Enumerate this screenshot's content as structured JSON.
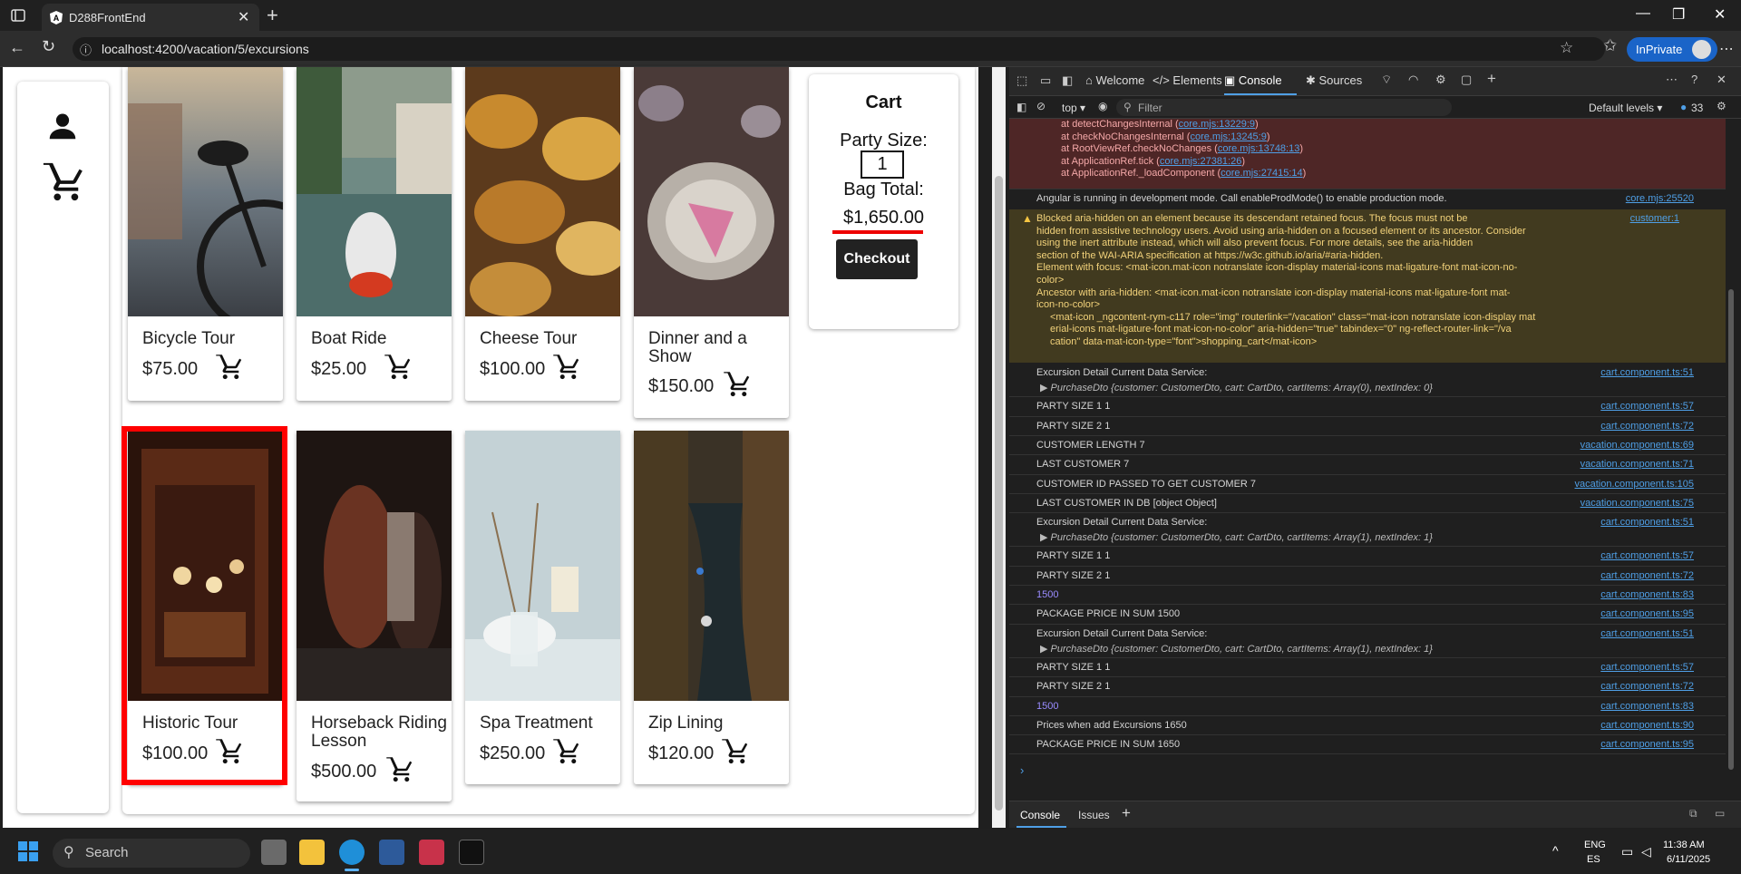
{
  "browser": {
    "tab_title": "D288FrontEnd",
    "url": "localhost:4200/vacation/5/excursions",
    "inprivate_label": "InPrivate"
  },
  "excursions": [
    {
      "title": "Bicycle Tour",
      "price": "$75.00"
    },
    {
      "title": "Boat Ride",
      "price": "$25.00"
    },
    {
      "title": "Cheese Tour",
      "price": "$100.00"
    },
    {
      "title": "Dinner and a Show",
      "price": "$150.00"
    },
    {
      "title": "Historic Tour",
      "price": "$100.00"
    },
    {
      "title": "Horseback Riding Lesson",
      "price": "$500.00"
    },
    {
      "title": "Spa Treatment",
      "price": "$250.00"
    },
    {
      "title": "Zip Lining",
      "price": "$120.00"
    }
  ],
  "cart": {
    "title": "Cart",
    "party_size_label": "Party Size:",
    "party_size_value": "1",
    "bag_total_label": "Bag Total:",
    "bag_total_value": "$1,650.00",
    "checkout_label": "Checkout"
  },
  "devtools": {
    "tabs": [
      "Welcome",
      "Elements",
      "Console",
      "Sources"
    ],
    "context": "top",
    "filter_placeholder": "Filter",
    "levels": "Default levels",
    "issue_count": "33",
    "bottom_tabs": [
      "Console",
      "Issues"
    ],
    "error_stack": [
      {
        "text": "at detectChangesInternal (",
        "src": "core.mjs:13229:9"
      },
      {
        "text": "at checkNoChangesInternal (",
        "src": "core.mjs:13245:9"
      },
      {
        "text": "at RootViewRef.checkNoChanges (",
        "src": "core.mjs:13748:13"
      },
      {
        "text": "at ApplicationRef.tick (",
        "src": "core.mjs:27381:26"
      },
      {
        "text": "at ApplicationRef._loadComponent (",
        "src": "core.mjs:27415:14"
      }
    ],
    "angular_msg": "Angular is running in development mode. Call enableProdMode() to enable production mode.",
    "angular_src": "core.mjs:25520",
    "warning_lines": [
      "Blocked aria-hidden on an element because its descendant retained focus. The focus must not be",
      "hidden from assistive technology users. Avoid using aria-hidden on a focused element or its ancestor. Consider",
      "using the inert attribute instead, which will also prevent focus. For more details, see the aria-hidden",
      "section of the WAI-ARIA specification at https://w3c.github.io/aria/#aria-hidden.",
      "Element with focus: <mat-icon.mat-icon notranslate icon-display material-icons mat-ligature-font mat-icon-no-",
      "color>",
      "Ancestor with aria-hidden: <mat-icon.mat-icon notranslate icon-display material-icons mat-ligature-font mat-",
      "icon-no-color>",
      "<mat-icon _ngcontent-rym-c117 role=\"img\" routerlink=\"/vacation\" class=\"mat-icon notranslate icon-display mat",
      "erial-icons mat-ligature-font mat-icon-no-color\" aria-hidden=\"true\" tabindex=\"0\" ng-reflect-router-link=\"/va",
      "cation\" data-mat-icon-type=\"font\">shopping_cart</mat-icon>"
    ],
    "warning_src": "customer:1",
    "logs": [
      {
        "text": "Excursion Detail Current Data Service:",
        "src": "cart.component.ts:51"
      },
      {
        "text": "▶ PurchaseDto {customer: CustomerDto, cart: CartDto, cartItems: Array(0), nextIndex: 0}",
        "src": ""
      },
      {
        "text": "PARTY SIZE 1 1",
        "src": "cart.component.ts:57"
      },
      {
        "text": "PARTY SIZE 2 1",
        "src": "cart.component.ts:72"
      },
      {
        "text": "CUSTOMER LENGTH 7",
        "src": "vacation.component.ts:69"
      },
      {
        "text": "LAST CUSTOMER 7",
        "src": "vacation.component.ts:71"
      },
      {
        "text": "CUSTOMER ID PASSED TO GET CUSTOMER 7",
        "src": "vacation.component.ts:105"
      },
      {
        "text": "LAST CUSTOMER IN DB [object Object]",
        "src": "vacation.component.ts:75"
      },
      {
        "text": "Excursion Detail Current Data Service:",
        "src": "cart.component.ts:51"
      },
      {
        "text": "▶ PurchaseDto {customer: CustomerDto, cart: CartDto, cartItems: Array(1), nextIndex: 1}",
        "src": ""
      },
      {
        "text": "PARTY SIZE 1 1",
        "src": "cart.component.ts:57"
      },
      {
        "text": "PARTY SIZE 2 1",
        "src": "cart.component.ts:72"
      },
      {
        "text": "1500",
        "src": "cart.component.ts:83"
      },
      {
        "text": "PACKAGE PRICE IN SUM 1500",
        "src": "cart.component.ts:95"
      },
      {
        "text": "Excursion Detail Current Data Service:",
        "src": "cart.component.ts:51"
      },
      {
        "text": "▶ PurchaseDto {customer: CustomerDto, cart: CartDto, cartItems: Array(1), nextIndex: 1}",
        "src": ""
      },
      {
        "text": "PARTY SIZE 1 1",
        "src": "cart.component.ts:57"
      },
      {
        "text": "PARTY SIZE 2 1",
        "src": "cart.component.ts:72"
      },
      {
        "text": "1500",
        "src": "cart.component.ts:83"
      },
      {
        "text": "Prices when add Excursions 1650",
        "src": "cart.component.ts:90"
      },
      {
        "text": "PACKAGE PRICE IN SUM 1650",
        "src": "cart.component.ts:95"
      }
    ]
  },
  "taskbar": {
    "search_placeholder": "Search",
    "lang_line1": "ENG",
    "lang_line2": "ES",
    "time": "11:38 AM",
    "date": "6/11/2025"
  }
}
